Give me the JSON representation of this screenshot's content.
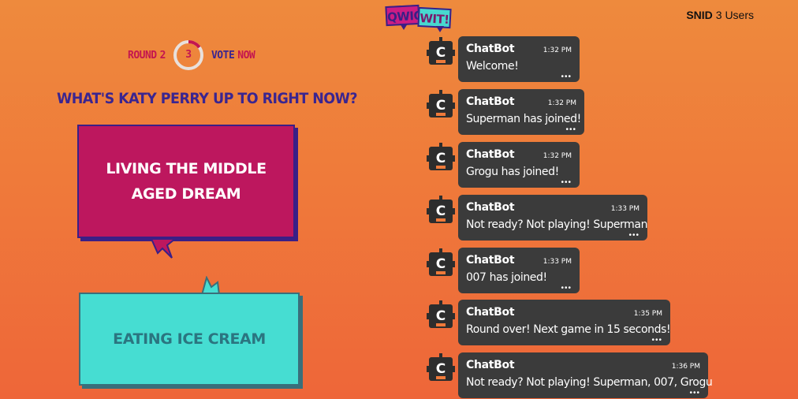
{
  "logo": {
    "part1": "QWIQ",
    "part2": "WIT!"
  },
  "user": {
    "name": "SNID",
    "count_label": "3 Users"
  },
  "status": {
    "round_label": "ROUND",
    "round_number": "2",
    "timer_value": "3",
    "timer_progress": 0.15,
    "vote_label": "VOTE",
    "now_label": "NOW"
  },
  "question": "WHAT'S KATY PERRY UP TO RIGHT NOW?",
  "answers": [
    {
      "text": "LIVING THE MIDDLE AGED DREAM",
      "color": "#bd175e"
    },
    {
      "text": "EATING ICE CREAM",
      "color": "#46ddd2"
    }
  ],
  "chat": {
    "bot_avatar_letter": "C",
    "messages": [
      {
        "sender": "ChatBot",
        "time": "1:32 PM",
        "text": "Welcome!",
        "more": "•••"
      },
      {
        "sender": "ChatBot",
        "time": "1:32 PM",
        "text": "Superman has joined!",
        "more": "•••"
      },
      {
        "sender": "ChatBot",
        "time": "1:32 PM",
        "text": "Grogu has joined!",
        "more": "•••"
      },
      {
        "sender": "ChatBot",
        "time": "1:33 PM",
        "text": "Not ready? Not playing! Superman",
        "more": "•••"
      },
      {
        "sender": "ChatBot",
        "time": "1:33 PM",
        "text": "007 has joined!",
        "more": "•••"
      },
      {
        "sender": "ChatBot",
        "time": "1:35 PM",
        "text": "Round over! Next game in 15 seconds!",
        "more": "•••"
      },
      {
        "sender": "ChatBot",
        "time": "1:36 PM",
        "text": "Not ready? Not playing! Superman, 007, Grogu",
        "more": "•••"
      }
    ]
  },
  "colors": {
    "accent_red": "#c4164f",
    "accent_purple": "#3a2590",
    "chat_bubble": "#3b3b3b"
  }
}
